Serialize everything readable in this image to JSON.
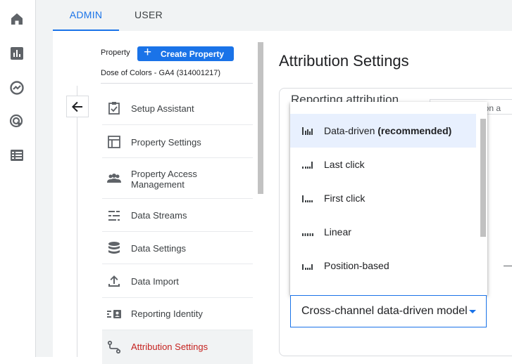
{
  "rail": {
    "icons": [
      "home-icon",
      "reports-icon",
      "explore-icon",
      "advertising-icon",
      "configure-icon"
    ]
  },
  "tabs": [
    {
      "label": "ADMIN",
      "active": true
    },
    {
      "label": "USER",
      "active": false
    }
  ],
  "property": {
    "label": "Property",
    "create_button": "Create Property",
    "name": "Dose of Colors - GA4 (314001217)"
  },
  "nav": {
    "items": [
      {
        "label": "Setup Assistant",
        "icon": "checklist-icon"
      },
      {
        "label": "Property Settings",
        "icon": "layout-icon"
      },
      {
        "label": "Property Access Management",
        "icon": "people-icon"
      },
      {
        "label": "Data Streams",
        "icon": "streams-icon"
      },
      {
        "label": "Data Settings",
        "icon": "database-icon"
      },
      {
        "label": "Data Import",
        "icon": "upload-icon"
      },
      {
        "label": "Reporting Identity",
        "icon": "identity-icon"
      },
      {
        "label": "Attribution Settings",
        "icon": "attribution-icon",
        "active": true
      }
    ]
  },
  "main": {
    "title": "Attribution Settings",
    "card_title": "Reporting attribution",
    "card_peek": "rsion a"
  },
  "dropdown": {
    "options": [
      {
        "label": "Data-driven",
        "suffix": "(recommended)",
        "selected": true
      },
      {
        "label": "Last click",
        "suffix": ""
      },
      {
        "label": "First click",
        "suffix": ""
      },
      {
        "label": "Linear",
        "suffix": ""
      },
      {
        "label": "Position-based",
        "suffix": ""
      }
    ],
    "current_value": "Cross-channel data-driven model"
  },
  "colors": {
    "accent": "#1a73e8",
    "active_nav_text": "#c5221f",
    "selected_option_bg": "#e8f0fe"
  }
}
